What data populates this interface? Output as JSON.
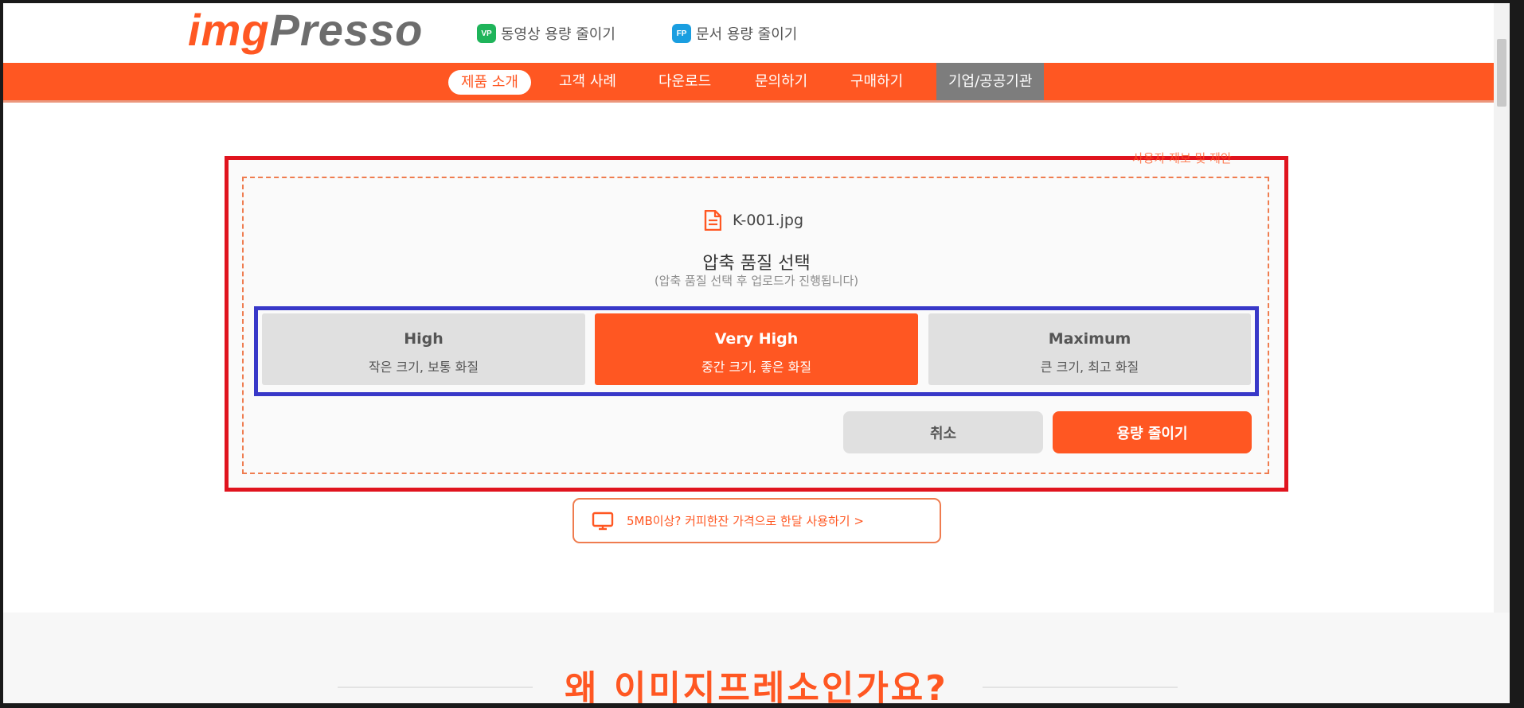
{
  "header": {
    "logo_img": "img",
    "logo_presso": "Presso",
    "links": [
      {
        "badge": "VP",
        "label": "동영상 용량 줄이기"
      },
      {
        "badge": "FP",
        "label": "문서 용량 줄이기"
      }
    ]
  },
  "nav": {
    "items": [
      "제품 소개",
      "고객 사례",
      "다운로드",
      "문의하기",
      "구매하기",
      "기업/공공기관"
    ],
    "active_index": 0
  },
  "panel": {
    "report_link": "사용자 제보 및 제안",
    "filename": "K-001.jpg",
    "title": "압축 품질 선택",
    "subtitle": "(압축 품질 선택 후 업로드가 진행됩니다)",
    "options": [
      {
        "name": "High",
        "desc": "작은 크기, 보통 화질",
        "selected": false
      },
      {
        "name": "Very High",
        "desc": "중간 크기, 좋은 화질",
        "selected": true
      },
      {
        "name": "Maximum",
        "desc": "큰 크기, 최고 화질",
        "selected": false
      }
    ],
    "cancel_label": "취소",
    "compress_label": "용량 줄이기"
  },
  "promo": {
    "label": "5MB이상? 커피한잔 가격으로 한달 사용하기 >"
  },
  "lower": {
    "heading": "왜 이미지프레소인가요?"
  },
  "colors": {
    "brand": "#ff5722",
    "highlight_red": "#e0141e",
    "highlight_blue": "#3838c8"
  }
}
